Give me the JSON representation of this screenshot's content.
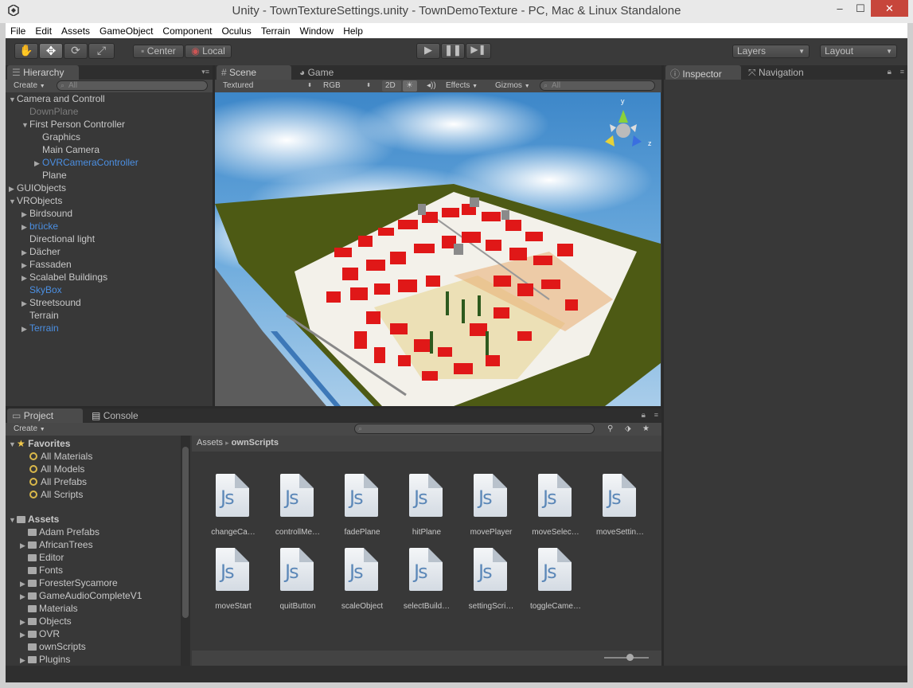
{
  "window": {
    "title": "Unity - TownTextureSettings.unity - TownDemoTexture - PC, Mac & Linux Standalone",
    "minimize": "–",
    "restore": "☐",
    "close": "✕"
  },
  "menu": [
    "File",
    "Edit",
    "Assets",
    "GameObject",
    "Component",
    "Oculus",
    "Terrain",
    "Window",
    "Help"
  ],
  "toolbar": {
    "pivot_center": "Center",
    "pivot_local": "Local",
    "layers": "Layers",
    "layout": "Layout"
  },
  "hierarchy": {
    "tab": "Hierarchy",
    "create": "Create",
    "search_placeholder": "All",
    "items": [
      {
        "label": "Camera and Controll",
        "depth": 0,
        "arrow": "open",
        "style": "normal"
      },
      {
        "label": "DownPlane",
        "depth": 1,
        "arrow": "none",
        "style": "dim"
      },
      {
        "label": "First Person Controller",
        "depth": 1,
        "arrow": "open",
        "style": "normal"
      },
      {
        "label": "Graphics",
        "depth": 2,
        "arrow": "none",
        "style": "normal"
      },
      {
        "label": "Main Camera",
        "depth": 2,
        "arrow": "none",
        "style": "normal"
      },
      {
        "label": "OVRCameraController",
        "depth": 2,
        "arrow": "closed",
        "style": "blue"
      },
      {
        "label": "Plane",
        "depth": 2,
        "arrow": "none",
        "style": "normal"
      },
      {
        "label": "GUIObjects",
        "depth": 0,
        "arrow": "closed",
        "style": "normal"
      },
      {
        "label": "VRObjects",
        "depth": 0,
        "arrow": "open",
        "style": "normal"
      },
      {
        "label": "Birdsound",
        "depth": 1,
        "arrow": "closed",
        "style": "normal"
      },
      {
        "label": "brücke",
        "depth": 1,
        "arrow": "closed",
        "style": "blue"
      },
      {
        "label": "Directional light",
        "depth": 1,
        "arrow": "none",
        "style": "normal"
      },
      {
        "label": "Dächer",
        "depth": 1,
        "arrow": "closed",
        "style": "normal"
      },
      {
        "label": "Fassaden",
        "depth": 1,
        "arrow": "closed",
        "style": "normal"
      },
      {
        "label": "Scalabel Buildings",
        "depth": 1,
        "arrow": "closed",
        "style": "normal"
      },
      {
        "label": "SkyBox",
        "depth": 1,
        "arrow": "none",
        "style": "blue"
      },
      {
        "label": "Streetsound",
        "depth": 1,
        "arrow": "closed",
        "style": "normal"
      },
      {
        "label": "Terrain",
        "depth": 1,
        "arrow": "none",
        "style": "normal"
      },
      {
        "label": "Terrain",
        "depth": 1,
        "arrow": "closed",
        "style": "blue"
      }
    ]
  },
  "scene": {
    "tab_scene": "Scene",
    "tab_game": "Game",
    "shading": "Textured",
    "render_mode": "RGB",
    "mode_2d": "2D",
    "effects": "Effects",
    "gizmos": "Gizmos",
    "search_placeholder": "All",
    "gizmo_y": "y",
    "gizmo_z": "z"
  },
  "inspector": {
    "tab_inspector": "Inspector",
    "tab_navigation": "Navigation"
  },
  "project": {
    "tab_project": "Project",
    "tab_console": "Console",
    "create": "Create",
    "favorites_label": "Favorites",
    "favorites": [
      "All Materials",
      "All Models",
      "All Prefabs",
      "All Scripts"
    ],
    "assets_label": "Assets",
    "folders": [
      {
        "label": "Adam Prefabs",
        "arrow": "none"
      },
      {
        "label": "AfricanTrees",
        "arrow": "closed"
      },
      {
        "label": "Editor",
        "arrow": "none"
      },
      {
        "label": "Fonts",
        "arrow": "none"
      },
      {
        "label": "ForesterSycamore",
        "arrow": "closed"
      },
      {
        "label": "GameAudioCompleteV1",
        "arrow": "closed"
      },
      {
        "label": "Materials",
        "arrow": "none"
      },
      {
        "label": "Objects",
        "arrow": "closed"
      },
      {
        "label": "OVR",
        "arrow": "closed"
      },
      {
        "label": "ownScripts",
        "arrow": "none"
      },
      {
        "label": "Plugins",
        "arrow": "closed"
      }
    ],
    "breadcrumb_root": "Assets",
    "breadcrumb_sep": "▸",
    "breadcrumb_current": "ownScripts",
    "script_glyph": "Js",
    "scripts": [
      "changeCa…",
      "controllMe…",
      "fadePlane",
      "hitPlane",
      "movePlayer",
      "moveSelec…",
      "moveSettin…",
      "moveStart",
      "quitButton",
      "scaleObject",
      "selectBuild…",
      "settingScri…",
      "toggleCame…"
    ]
  }
}
